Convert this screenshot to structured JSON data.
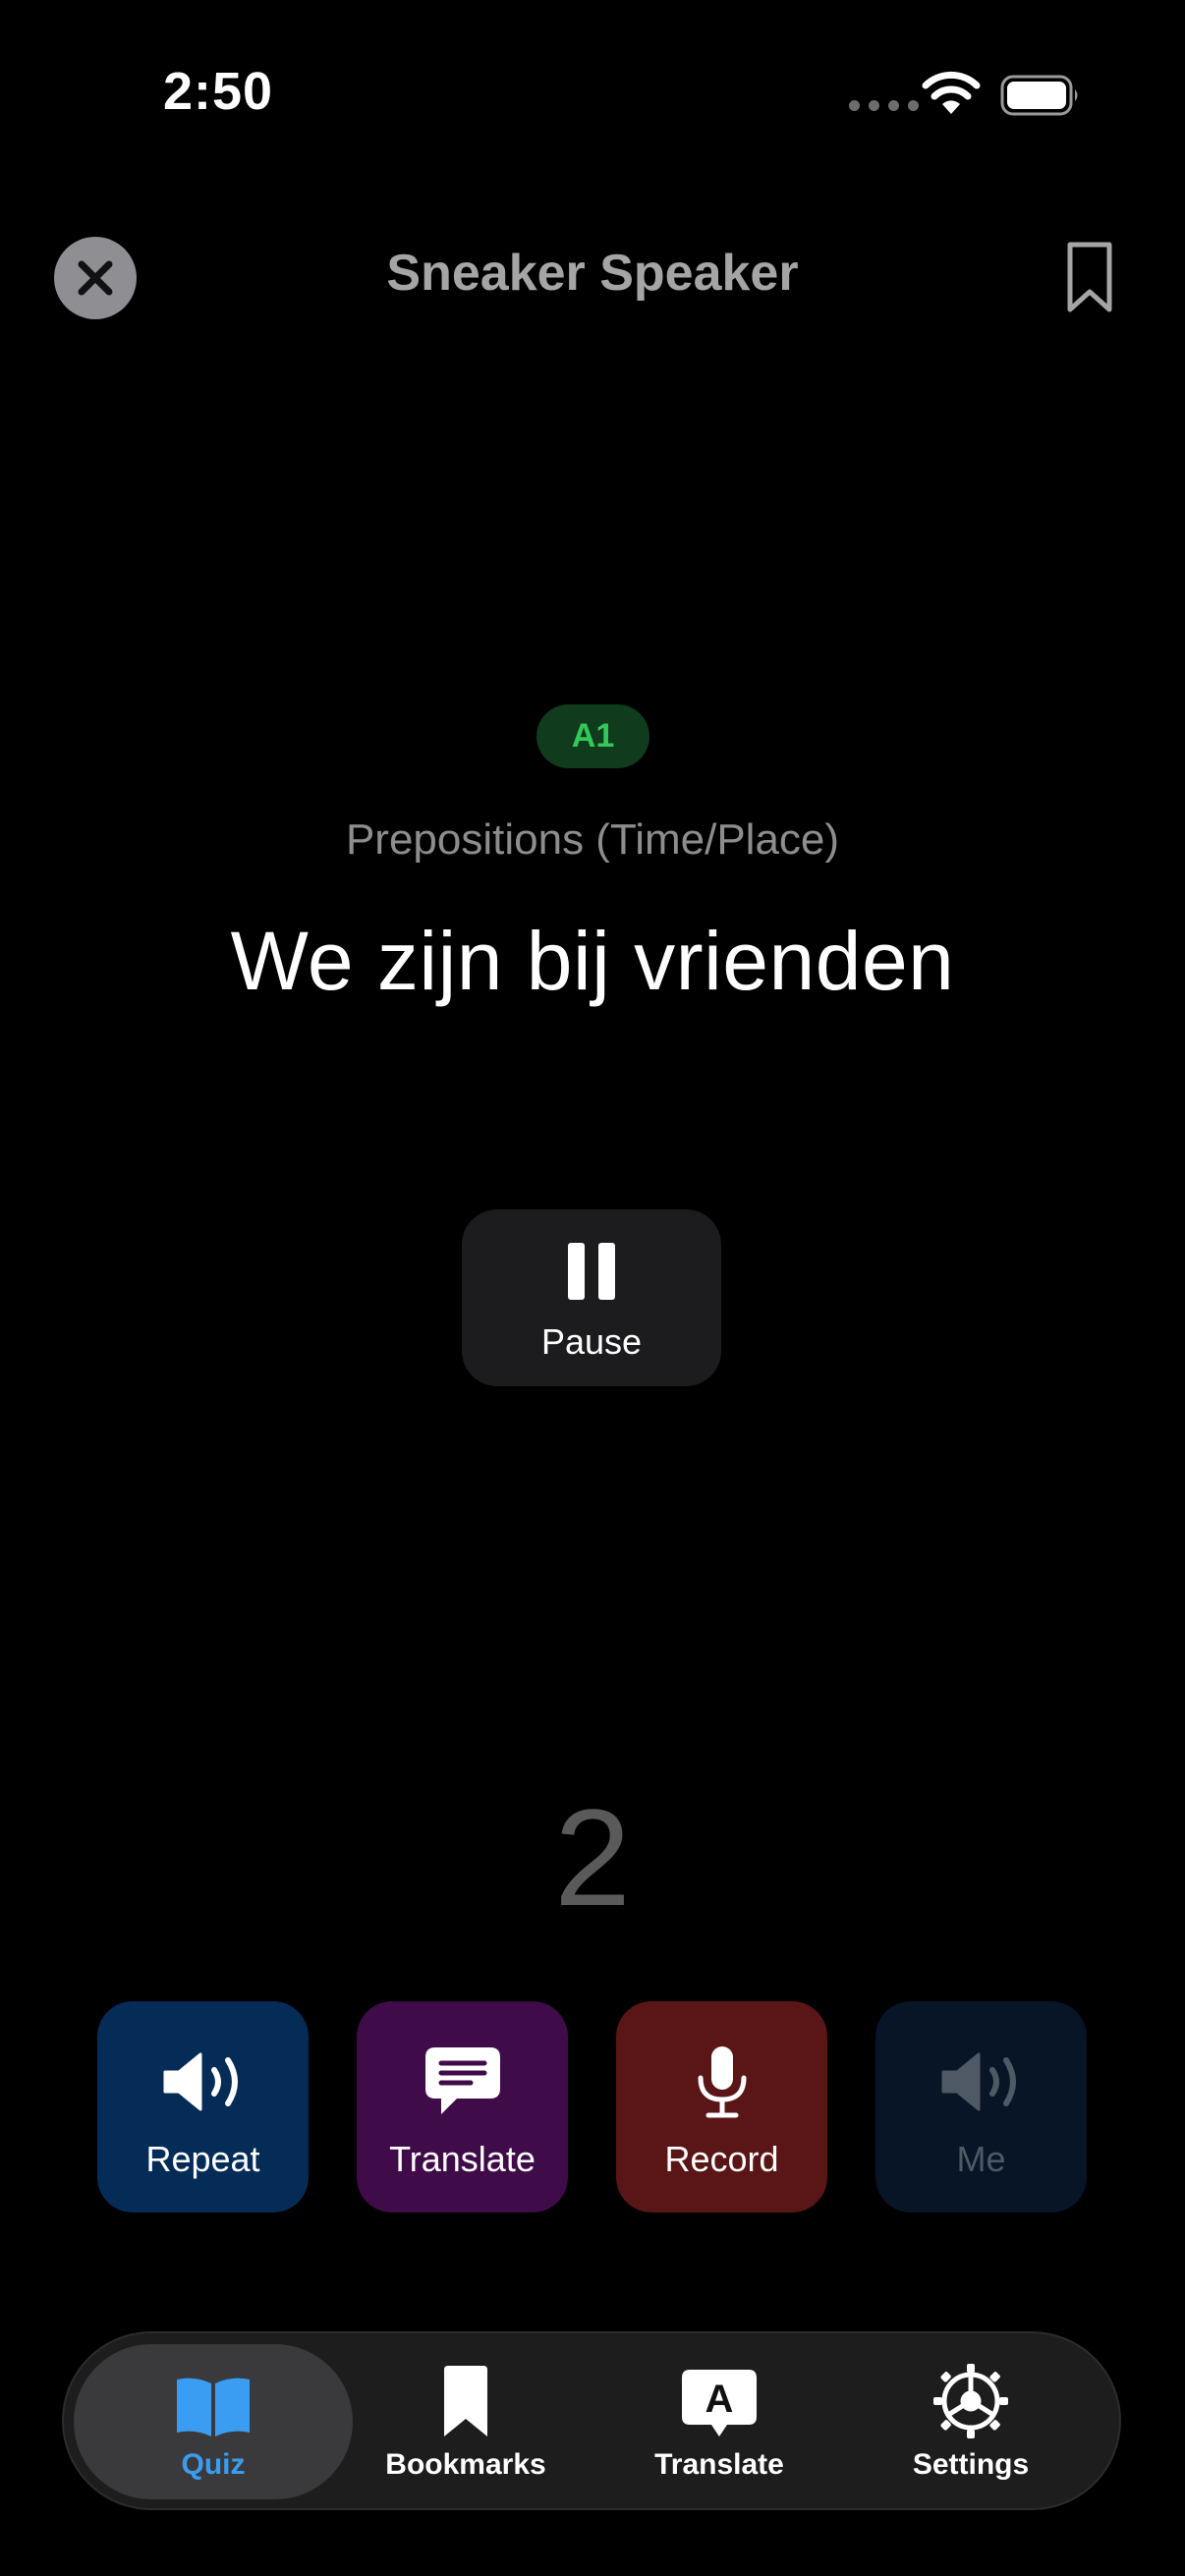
{
  "status_bar": {
    "time": "2:50"
  },
  "header": {
    "title": "Sneaker Speaker"
  },
  "card": {
    "level": "A1",
    "category": "Prepositions (Time/Place)",
    "sentence": "We zijn bij vrienden",
    "pause_label": "Pause",
    "countdown": "2"
  },
  "actions": {
    "repeat": "Repeat",
    "translate": "Translate",
    "record": "Record",
    "me": "Me"
  },
  "tabs": {
    "quiz": "Quiz",
    "bookmarks": "Bookmarks",
    "translate": "Translate",
    "settings": "Settings",
    "translate_glyph": "A"
  },
  "colors": {
    "accent_blue": "#3a9df2",
    "level_green": "#34c759",
    "repeat_bg": "#052b57",
    "translate_bg": "#3f0c49",
    "record_bg": "#5a1616",
    "me_bg": "#071527"
  }
}
